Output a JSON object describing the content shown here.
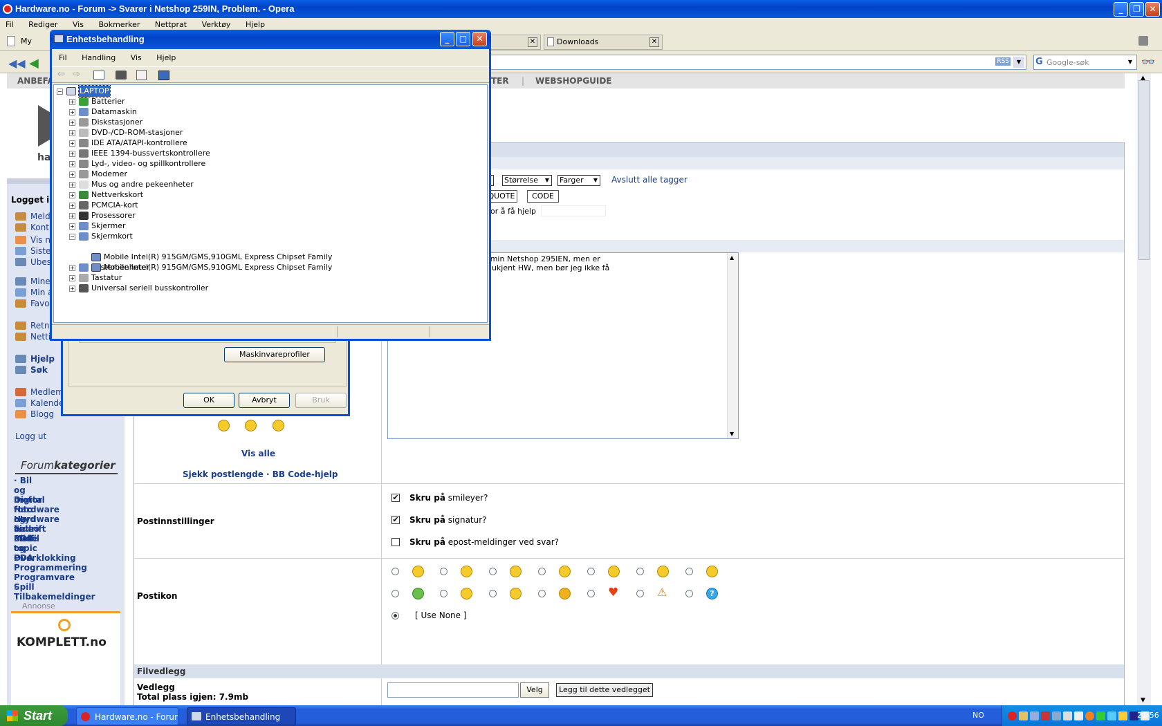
{
  "opera": {
    "title": "Hardware.no - Forum -> Svarer i Netshop 259IN, Problem. - Opera",
    "menu": [
      "Fil",
      "Rediger",
      "Vis",
      "Bokmerker",
      "Nettprat",
      "Verktøy",
      "Hjelp"
    ],
    "tabs": {
      "my_side": "My side",
      "downloads": "Downloads"
    },
    "search_placeholder": "Google-søk",
    "rss": "RSS"
  },
  "site": {
    "nav_left": "ANBEFA",
    "nav_items": [
      "TER",
      "WEBSHOPGUIDE"
    ],
    "logo_fragment": "ha"
  },
  "sidebar": {
    "logged_in": "Logget inn",
    "group1": [
      "Meld",
      "Kont"
    ],
    "group2": [
      "Vis n",
      "Siste",
      "Ubesv"
    ],
    "group3": [
      "Mine",
      "Min a",
      "Favo"
    ],
    "group4": [
      "Retnings",
      "Nettiket"
    ],
    "help": "Hjelp",
    "search": "Søk",
    "members": "Medlemsliste",
    "calendar": "Kalender",
    "blog": "Blogg",
    "logout": "Logg ut",
    "forum_cat_a": "Forum",
    "forum_cat_b": "kategorier",
    "categories": [
      "· Bil og motor",
      "· Digital foto og video",
      "· Hardware",
      "· Hardware bedrift",
      "· Lyd & Bilde",
      "· Mobil og PDA",
      "· Off topic",
      "· Overklokking",
      "· Programmering",
      "· Programvare",
      "· Spill",
      "· Tilbakemeldinger"
    ],
    "ad_label": "Annonse",
    "ad_brand": "KOMPLETT.no"
  },
  "editor": {
    "size_select": "Størrelse",
    "color_select": "Farger",
    "close_tags": "Avslutt alle tagger",
    "quote_btn": "QUOTE",
    "code_btn": "CODE",
    "help_text": "or å få hjelp",
    "message": "he tråden litt. Jeg har fått min Netshop 295IEN, men er\n0 er lagt inn. Det er ingen ukjent HW, men bør jeg ikke få\ner på bryteren da?",
    "show_all": "Vis alle",
    "check_length": "Sjekk postlengde · BB Code-hjelp"
  },
  "post_settings": {
    "label": "Postinnstillinger",
    "options": [
      {
        "bold": "Skru på",
        "rest": " smileyer?",
        "checked": "✔"
      },
      {
        "bold": "Skru på",
        "rest": " signatur?",
        "checked": "✔"
      },
      {
        "bold": "Skru på",
        "rest": " epost-meldinger ved svar?",
        "checked": ""
      }
    ]
  },
  "post_icon": {
    "label": "Postikon",
    "use_none": "[ Use None ]"
  },
  "attachments": {
    "header": "Filvedlegg",
    "label": "Vedlegg",
    "space": "Total plass igjen: 7.9mb",
    "choose": "Velg",
    "add": "Legg til dette vedlegget"
  },
  "device_manager": {
    "title": "Enhetsbehandling",
    "menu": [
      "Fil",
      "Handling",
      "Vis",
      "Hjelp"
    ],
    "root": "LAPTOP",
    "nodes": [
      {
        "label": "Batterier",
        "exp": "+"
      },
      {
        "label": "Datamaskin",
        "exp": "+"
      },
      {
        "label": "Diskstasjoner",
        "exp": "+"
      },
      {
        "label": "DVD-/CD-ROM-stasjoner",
        "exp": "+"
      },
      {
        "label": "IDE ATA/ATAPI-kontrollere",
        "exp": "+"
      },
      {
        "label": "IEEE 1394-bussvertskontrollere",
        "exp": "+"
      },
      {
        "label": "Lyd-, video- og spillkontrollere",
        "exp": "+"
      },
      {
        "label": "Modemer",
        "exp": "+"
      },
      {
        "label": "Mus og andre pekeenheter",
        "exp": "+"
      },
      {
        "label": "Nettverkskort",
        "exp": "+"
      },
      {
        "label": "PCMCIA-kort",
        "exp": "+"
      },
      {
        "label": "Prosessorer",
        "exp": "+"
      },
      {
        "label": "Skjermer",
        "exp": "+"
      },
      {
        "label": "Skjermkort",
        "exp": "−"
      },
      {
        "label": "Systemenheter",
        "exp": "+"
      },
      {
        "label": "Tastatur",
        "exp": "+"
      },
      {
        "label": "Universal seriell busskontroller",
        "exp": "+"
      }
    ],
    "children": [
      "Mobile Intel(R) 915GM/GMS,910GML Express Chipset Family",
      "Mobile Intel(R) 915GM/GMS,910GML Express Chipset Family"
    ]
  },
  "system_props": {
    "hw_profiles": "Maskinvareprofiler",
    "ok": "OK",
    "cancel": "Avbryt",
    "apply": "Bruk"
  },
  "taskbar": {
    "start": "Start",
    "task1": "Hardware.no - Forum...",
    "task2": "Enhetsbehandling",
    "lang": "NO",
    "clock": "21:56"
  },
  "colors": {
    "xp_blue": "#0a5fe6",
    "forum_blue": "#1b3c8c",
    "sidebar_bg": "#dfe5f2"
  }
}
